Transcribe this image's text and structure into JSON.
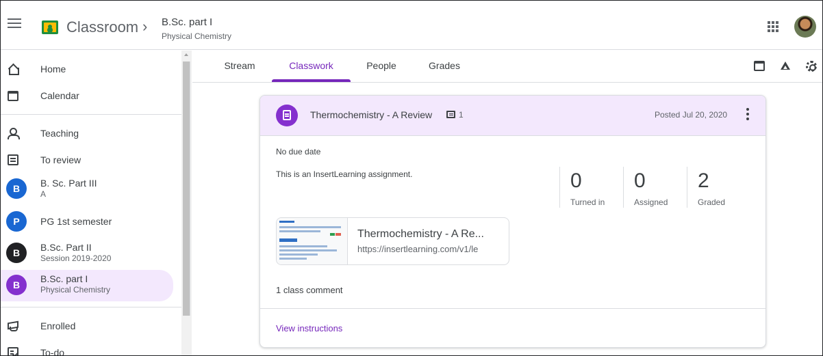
{
  "header": {
    "app_title": "Classroom",
    "breadcrumb_chevron": "›",
    "class_name": "B.Sc. part I",
    "class_section": "Physical Chemistry",
    "icons": [
      "menu-icon",
      "classroom-logo-icon",
      "apps-grid-icon",
      "avatar"
    ]
  },
  "sidebar": {
    "home": "Home",
    "calendar": "Calendar",
    "teaching": "Teaching",
    "to_review": "To review",
    "classes": [
      {
        "initial": "B",
        "name": "B. Sc. Part III",
        "section": "A",
        "color": "#1967d2"
      },
      {
        "initial": "P",
        "name": "PG 1st semester",
        "section": "",
        "color": "#1967d2"
      },
      {
        "initial": "B",
        "name": "B.Sc. Part II",
        "section": "Session 2019-2020",
        "color": "#202124"
      },
      {
        "initial": "B",
        "name": "B.Sc. part I",
        "section": "Physical Chemistry",
        "color": "#8430ce"
      }
    ],
    "enrolled": "Enrolled",
    "todo": "To-do"
  },
  "tabs": [
    {
      "label": "Stream"
    },
    {
      "label": "Classwork"
    },
    {
      "label": "People"
    },
    {
      "label": "Grades"
    }
  ],
  "assignment": {
    "title": "Thermochemistry - A Review",
    "comment_count": "1",
    "posted": "Posted Jul 20, 2020",
    "due": "No due date",
    "description": "This is an InsertLearning assignment.",
    "stats": [
      {
        "value": "0",
        "label": "Turned in"
      },
      {
        "value": "0",
        "label": "Assigned"
      },
      {
        "value": "2",
        "label": "Graded"
      }
    ],
    "attachment": {
      "title": "Thermochemistry - A Re...",
      "url": "https://insertlearning.com/v1/le"
    },
    "class_comment": "1 class comment",
    "view_instructions": "View instructions"
  },
  "colors": {
    "accent": "#7627bb",
    "card_header": "#f3e8fd",
    "assignment_icon": "#8430ce"
  }
}
